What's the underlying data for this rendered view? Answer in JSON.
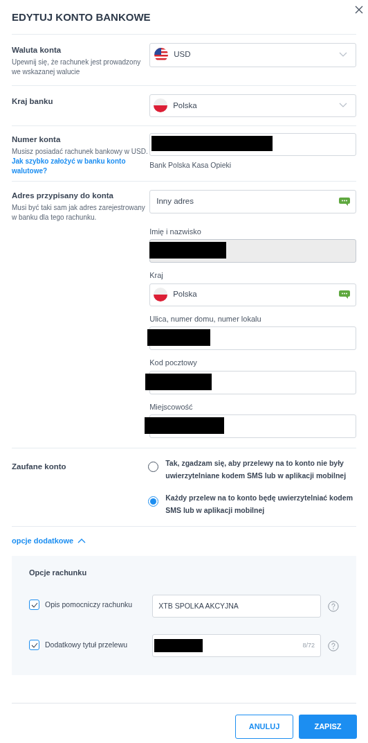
{
  "dialog": {
    "title": "EDYTUJ KONTO BANKOWE"
  },
  "currency": {
    "label": "Waluta konta",
    "hint": "Upewnij się, że rachunek jest prowadzony we wskazanej walucie",
    "kind": "us",
    "value": "USD"
  },
  "bank_country": {
    "label": "Kraj banku",
    "kind": "pl",
    "value": "Polska"
  },
  "account_number": {
    "label": "Numer konta",
    "hint": "Musisz posiadać rachunek bankowy w USD.",
    "link": "Jak szybko założyć w banku konto walutowe?",
    "redacted": true,
    "bank": "Bank Polska Kasa Opieki"
  },
  "address": {
    "label": "Adres przypisany do konta",
    "hint": "Musi być taki sam jak adres zarejestrowany w banku dla tego rachunku.",
    "source": {
      "value": "Inny adres"
    },
    "fields": [
      {
        "kind": "text",
        "label": "Imię i nazwisko",
        "redacted": true,
        "disabled": true
      },
      {
        "kind": "pl",
        "label": "Kraj",
        "value": "Polska"
      },
      {
        "kind": "text",
        "label": "Ulica, numer domu, numer lokalu",
        "redacted": true,
        "disabled": false
      },
      {
        "kind": "text",
        "label": "Kod pocztowy",
        "redacted": true,
        "disabled": false
      },
      {
        "kind": "text",
        "label": "Miejscowość",
        "redacted": true,
        "disabled": false
      }
    ]
  },
  "trusted_account": {
    "label": "Zaufane konto",
    "options": [
      {
        "label": "Tak, zgadzam się, aby przelewy na to konto nie były uwierzytelniane kodem SMS lub w aplikacji mobilnej",
        "selected": false
      },
      {
        "label": "Każdy przelew na to konto będę uwierzytelniać kodem SMS lub w aplikacji mobilnej",
        "selected": true
      }
    ]
  },
  "extra_options": {
    "label": "opcje dodatkowe",
    "expanded": true,
    "title": "Opcje rachunku",
    "rows": [
      {
        "label": "Opis pomocniczy rachunku",
        "checked": true,
        "value": "XTB SPOLKA AKCYJNA",
        "redacted": false
      },
      {
        "label": "Dodatkowy tytuł przelewu",
        "checked": true,
        "redacted": true,
        "counter": "8/72"
      }
    ]
  },
  "buttons": [
    {
      "kind": "secondary",
      "label": "ANULUJ"
    },
    {
      "kind": "primary",
      "label": "ZAPISZ"
    }
  ]
}
